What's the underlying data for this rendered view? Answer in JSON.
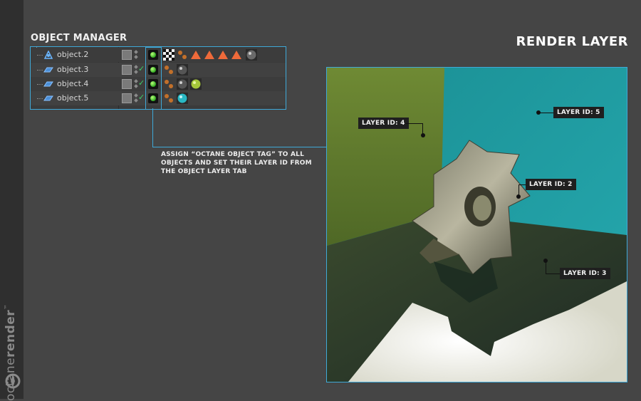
{
  "side_brand": {
    "text_light": "octane",
    "text_bold": "render",
    "trademark": "™"
  },
  "object_manager": {
    "title": "OBJECT MANAGER",
    "objects": [
      {
        "name": "object.2",
        "icon": "null-object-icon"
      },
      {
        "name": "object.3",
        "icon": "plane-object-icon"
      },
      {
        "name": "object.4",
        "icon": "plane-object-icon"
      },
      {
        "name": "object.5",
        "icon": "plane-object-icon"
      }
    ]
  },
  "callout": {
    "text": "ASSIGN “OCTANE OBJECT TAG” TO ALL OBJECTS AND SET THEIR LAYER ID FROM THE OBJECT LAYER TAB"
  },
  "render": {
    "title": "RENDER LAYER",
    "layers": [
      {
        "label": "LAYER ID: 4"
      },
      {
        "label": "LAYER ID: 5"
      },
      {
        "label": "LAYER ID: 2"
      },
      {
        "label": "LAYER ID: 3"
      }
    ]
  },
  "colors": {
    "accent": "#3fa9d8",
    "background": "#454545",
    "wall_green": "#6f8a34",
    "wall_teal": "#1f9aa0",
    "floor_dark": "#2f3f2a"
  }
}
